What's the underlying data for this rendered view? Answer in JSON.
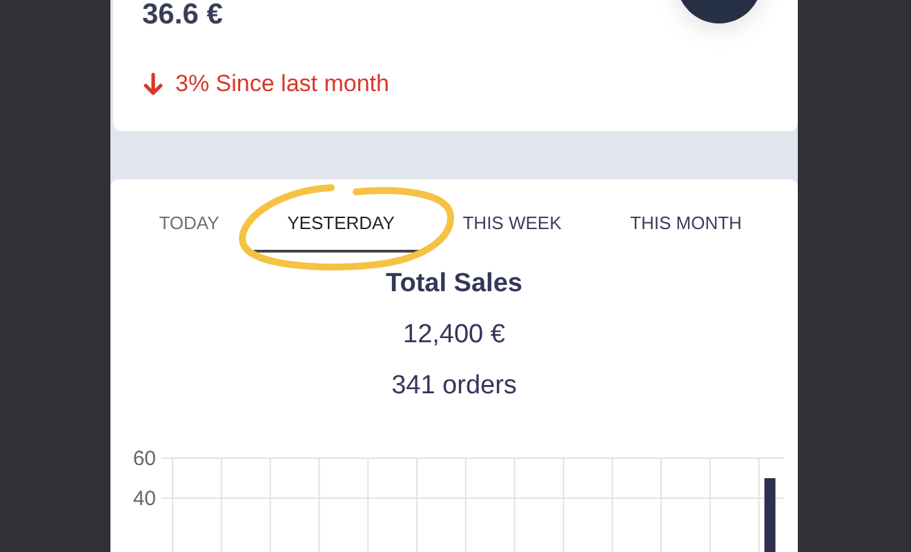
{
  "summary": {
    "value": "36.6 €",
    "trend": {
      "negative": true,
      "text": "3% Since last month"
    }
  },
  "tabs": [
    {
      "label": "TODAY",
      "selected": false
    },
    {
      "label": "YESTERDAY",
      "selected": true
    },
    {
      "label": "THIS WEEK",
      "selected": false
    },
    {
      "label": "THIS MONTH",
      "selected": false
    }
  ],
  "sales": {
    "title": "Total Sales",
    "amount": "12,400 €",
    "orders": "341 orders",
    "chart_data": {
      "type": "bar",
      "values": [
        0,
        0,
        0,
        0,
        0,
        0,
        0,
        0,
        0,
        0,
        0,
        0,
        50
      ],
      "ylim": [
        0,
        60
      ],
      "yticks": [
        40,
        60
      ],
      "grid": true
    }
  }
}
